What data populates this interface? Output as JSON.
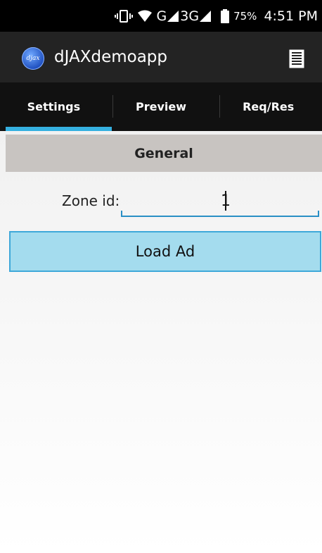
{
  "status_bar": {
    "network_label": "G",
    "network_3g_label": "3G",
    "battery": "75%",
    "time": "4:51 PM"
  },
  "app_bar": {
    "logo_text": "djax",
    "title": "dJAXdemoapp",
    "menu_icon": "list-icon"
  },
  "tabs": [
    {
      "label": "Settings",
      "selected": true
    },
    {
      "label": "Preview",
      "selected": false
    },
    {
      "label": "Req/Res",
      "selected": false
    }
  ],
  "colors": {
    "tab_indicator": "#35b0e0",
    "button_fill": "#a4dcee",
    "button_border": "#3ea8d9",
    "input_underline": "#2a8fc5"
  },
  "settings": {
    "section_title": "General",
    "zone_label": "Zone id:",
    "zone_value": "1",
    "load_button_label": "Load Ad"
  }
}
